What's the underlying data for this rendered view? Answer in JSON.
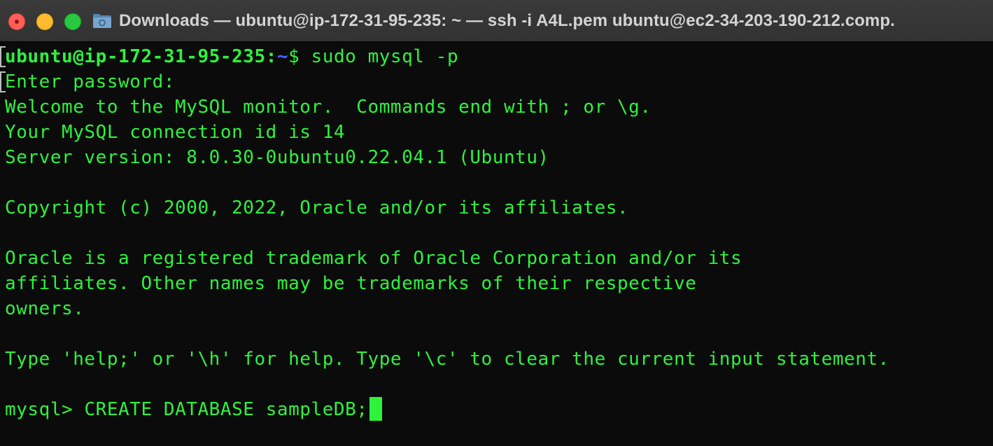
{
  "window": {
    "title": "Downloads — ubuntu@ip-172-31-95-235: ~ — ssh -i A4L.pem ubuntu@ec2-34-203-190-212.comp.",
    "title_icon": "folder-icon",
    "traffic_lights": [
      "close",
      "minimize",
      "zoom"
    ]
  },
  "colors": {
    "terminal_text": "#2ef23e",
    "terminal_background": "#0b0b0b",
    "path_color": "#4a63ff",
    "titlebar": "#363636"
  },
  "terminal": {
    "prompt": {
      "user_host": "ubuntu@ip-172-31-95-235",
      "separator": ":",
      "path": "~",
      "symbol": "$",
      "command": " sudo mysql -p"
    },
    "lines": {
      "enter_password": "Enter password:",
      "welcome": "Welcome to the MySQL monitor.  Commands end with ; or \\g.",
      "connection_id": "Your MySQL connection id is 14",
      "server_version": "Server version: 8.0.30-0ubuntu0.22.04.1 (Ubuntu)",
      "copyright": "Copyright (c) 2000, 2022, Oracle and/or its affiliates.",
      "trademark_1": "Oracle is a registered trademark of Oracle Corporation and/or its",
      "trademark_2": "affiliates. Other names may be trademarks of their respective",
      "trademark_3": "owners.",
      "help": "Type 'help;' or '\\h' for help. Type '\\c' to clear the current input statement."
    },
    "mysql_prompt": "mysql> ",
    "current_input": "CREATE DATABASE sampleDB;"
  }
}
